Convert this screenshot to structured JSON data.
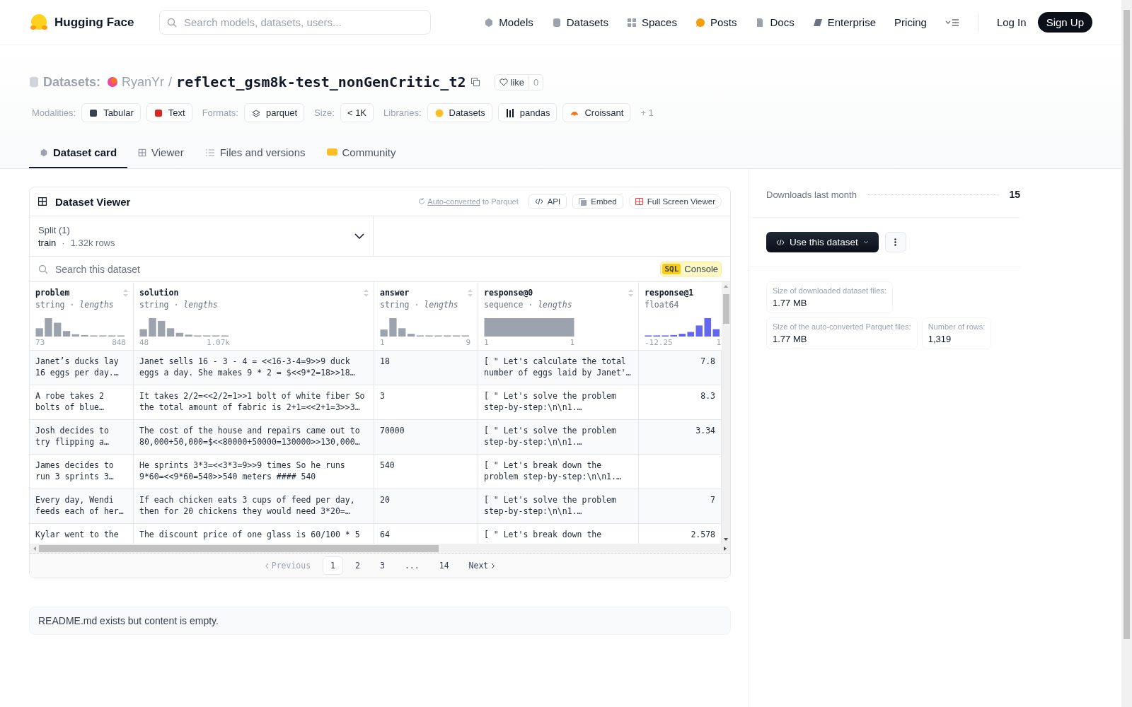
{
  "nav": {
    "brand": "Hugging Face",
    "search": {
      "placeholder": "Search models, datasets, users..."
    },
    "links": [
      {
        "label": "Models"
      },
      {
        "label": "Datasets"
      },
      {
        "label": "Spaces"
      },
      {
        "label": "Posts"
      },
      {
        "label": "Docs"
      },
      {
        "label": "Enterprise"
      },
      {
        "label": "Pricing"
      }
    ],
    "login": "Log In",
    "signup": "Sign Up"
  },
  "repo": {
    "section": "Datasets:",
    "owner": "RyanYr",
    "separator": "/",
    "name": "reflect_gsm8k-test_nonGenCritic_t2",
    "like_label": "like",
    "like_count": "0"
  },
  "tag_groups": [
    {
      "label": "Modalities:",
      "tags": [
        "Tabular",
        "Text"
      ]
    },
    {
      "label": "Formats:",
      "tags": [
        "parquet"
      ]
    },
    {
      "label": "Size:",
      "tags": [
        "< 1K"
      ]
    },
    {
      "label": "Libraries:",
      "tags": [
        "Datasets",
        "pandas",
        "Croissant"
      ]
    }
  ],
  "more_tags": "+ 1",
  "tabs": [
    {
      "label": "Dataset card",
      "selected": true
    },
    {
      "label": "Viewer",
      "selected": false
    },
    {
      "label": "Files and versions",
      "selected": false
    },
    {
      "label": "Community",
      "selected": false
    }
  ],
  "viewer": {
    "title": "Dataset Viewer",
    "converted_link": "Auto-converted",
    "converted_rest": "to Parquet",
    "buttons": [
      "API",
      "Embed",
      "Full Screen Viewer"
    ],
    "split": {
      "label": "Split (1)",
      "value": "train",
      "separator": "·",
      "rows": "1.32k rows"
    },
    "search": {
      "placeholder": "Search this dataset"
    },
    "sql_badge": "SQL",
    "sql_label": "Console",
    "columns": [
      {
        "name": "problem",
        "type_line": "string · *lengths*",
        "kind": "string",
        "min": "73",
        "max": "848",
        "sortable": true
      },
      {
        "name": "solution",
        "type_line": "string · *lengths*",
        "kind": "string",
        "min": "48",
        "max": "1.07k",
        "sortable": true
      },
      {
        "name": "answer",
        "type_line": "string · *lengths*",
        "kind": "string",
        "min": "1",
        "max": "9",
        "sortable": true
      },
      {
        "name": "response@0",
        "type_line": "sequence · *lengths*",
        "kind": "string",
        "min": "1",
        "max": "1",
        "sortable": true
      },
      {
        "name": "response@1",
        "type_line": "float64",
        "kind": "numeric",
        "min": "-12.25",
        "max": "1",
        "sortable": false
      }
    ],
    "rows": [
      [
        "Janet’s ducks lay 16 eggs per day.…",
        "Janet sells 16 - 3 - 4 = <<16-3-4=9>>9 duck eggs a day. She makes 9 * 2 = $<<9*2=18>>18…",
        "18",
        "[ \" Let's calculate the total number of eggs laid by Janet'…",
        "7.8"
      ],
      [
        "A robe takes 2 bolts of blue…",
        "It takes 2/2=<<2/2=1>>1 bolt of white fiber So the total amount of fabric is 2+1=<<2+1=3>>3…",
        "3",
        "[ \" Let's solve the problem step-by-step:\\n\\n1.…",
        "8.3"
      ],
      [
        "Josh decides to try flipping a…",
        "The cost of the house and repairs came out to 80,000+50,000=$<<80000+50000=130000>>130,000…",
        "70000",
        "[ \" Let's solve the problem step-by-step:\\n\\n1.…",
        "3.34"
      ],
      [
        "James decides to run 3 sprints 3…",
        "He sprints 3*3=<<3*3=9>>9 times So he runs 9*60=<<9*60=540>>540 meters #### 540",
        "540",
        "[ \" Let's break down the problem step-by-step:\\n\\n1.…",
        ""
      ],
      [
        "Every day, Wendi feeds each of her…",
        "If each chicken eats 3 cups of feed per day, then for 20 chickens they would need 3*20=…",
        "20",
        "[ \" Let's solve the problem step-by-step:\\n\\n1.…",
        "7"
      ],
      [
        "Kylar went to the",
        "The discount price of one glass is 60/100 * 5",
        "64",
        "[ \" Let's break down the",
        "2.578"
      ]
    ],
    "pagination": {
      "previous": "Previous",
      "next": "Next",
      "pages": [
        {
          "label": "1",
          "selected": true
        },
        {
          "label": "2",
          "selected": false
        },
        {
          "label": "3",
          "selected": false
        },
        {
          "label": "...",
          "selected": false
        },
        {
          "label": "14",
          "selected": false
        }
      ]
    }
  },
  "readme_note": "README.md exists but content is empty.",
  "sidebar": {
    "downloads_label": "Downloads last month",
    "downloads_value": "15",
    "use_button": "Use this dataset",
    "stats": [
      {
        "label": "Size of downloaded dataset files:",
        "value": "1.77 MB"
      },
      {
        "label": "Size of the auto-converted Parquet files:",
        "value": "1.77 MB"
      },
      {
        "label": "Number of rows:",
        "value": "1,319"
      }
    ]
  }
}
